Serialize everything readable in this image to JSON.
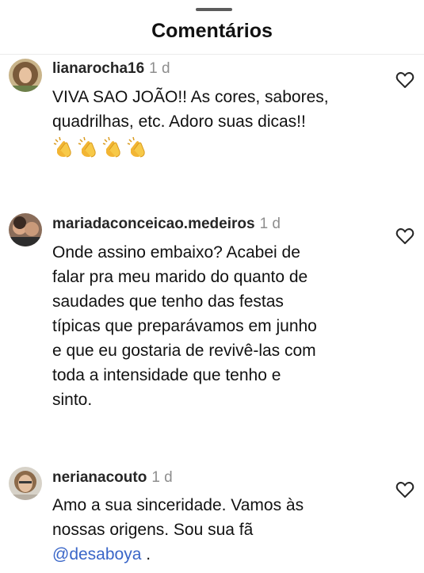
{
  "header": {
    "title": "Comentários"
  },
  "comments": [
    {
      "username": "lianarocha16",
      "time": "1 d",
      "text": "VIVA SAO JOÃO!! As cores, sabores,\nquadrilhas, etc. Adoro suas dicas!!",
      "emoji_count": 4,
      "avatar_icon": "user-avatar"
    },
    {
      "username": "mariadaconceicao.medeiros",
      "time": "1 d",
      "text": "Onde assino embaixo? Acabei de\nfalar pra meu marido do quanto de\nsaudades que tenho das festas\ntípicas que preparávamos em junho\ne que eu gostaria de revivê-las  com\ntoda a intensidade que tenho e\nsinto.",
      "avatar_icon": "user-avatar"
    },
    {
      "username": "nerianacouto",
      "time": "1 d",
      "text": "Amo a sua sinceridade. Vamos às\nnossas origens. Sou sua fã",
      "mention": "@desaboya",
      "mention_suffix": " .",
      "avatar_icon": "user-avatar"
    }
  ],
  "colors": {
    "text": "#111111",
    "muted": "#8e8e8e",
    "mention": "#3a66c8"
  }
}
